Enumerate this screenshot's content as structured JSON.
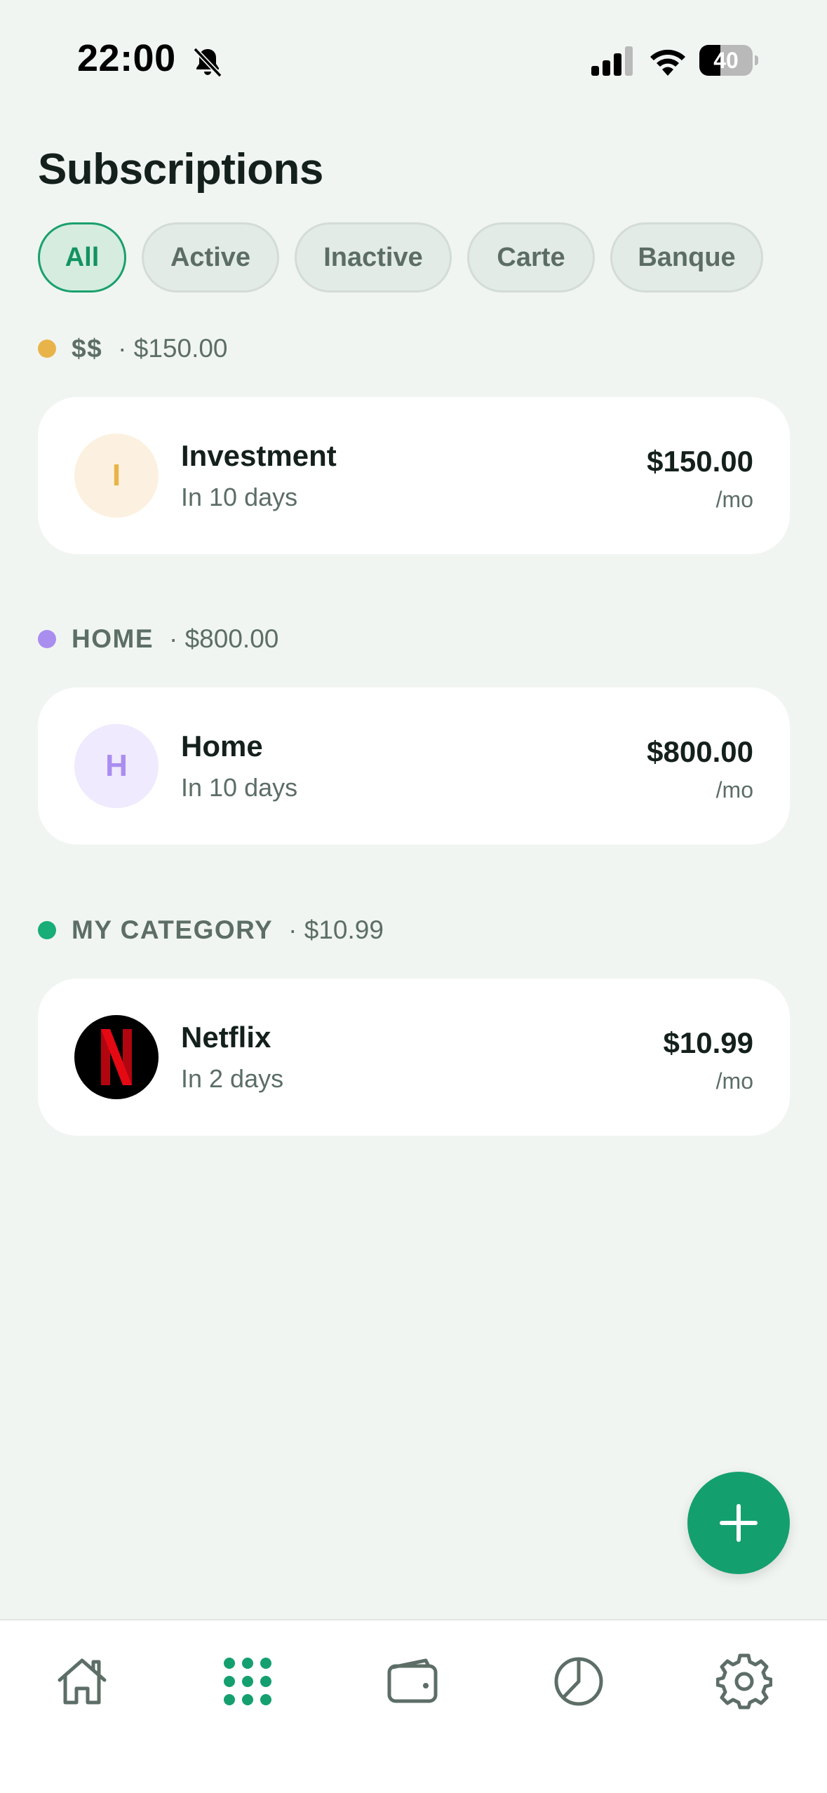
{
  "status_bar": {
    "time": "22:00",
    "battery_level": "40",
    "battery_fraction": 0.4
  },
  "page": {
    "title": "Subscriptions"
  },
  "filters": {
    "chips": [
      {
        "label": "All",
        "selected": true
      },
      {
        "label": "Active",
        "selected": false
      },
      {
        "label": "Inactive",
        "selected": false
      },
      {
        "label": "Carte",
        "selected": false
      },
      {
        "label": "Banque",
        "selected": false
      }
    ]
  },
  "sections": [
    {
      "name": "$$",
      "total": "· $150.00",
      "color": "#e8b44a",
      "items": [
        {
          "name": "Investment",
          "due": "In 10 days",
          "price": "$150.00",
          "period": "/mo",
          "initial": "I",
          "avatar_bg": "#fcf1e0",
          "avatar_fg": "#e8b44a"
        }
      ]
    },
    {
      "name": "HOME",
      "total": "· $800.00",
      "color": "#a98ef0",
      "items": [
        {
          "name": "Home",
          "due": "In 10 days",
          "price": "$800.00",
          "period": "/mo",
          "initial": "H",
          "avatar_bg": "#efeafd",
          "avatar_fg": "#a98ef0"
        }
      ]
    },
    {
      "name": "MY CATEGORY",
      "total": "· $10.99",
      "color": "#19ad78",
      "items": [
        {
          "name": "Netflix",
          "due": "In 2 days",
          "price": "$10.99",
          "period": "/mo",
          "icon": "netflix-logo"
        }
      ]
    }
  ],
  "tab_bar": {
    "tabs": [
      {
        "icon": "home-icon",
        "selected": false
      },
      {
        "icon": "grid-icon",
        "selected": true
      },
      {
        "icon": "wallet-icon",
        "selected": false
      },
      {
        "icon": "pie-chart-icon",
        "selected": false
      },
      {
        "icon": "gear-icon",
        "selected": false
      }
    ],
    "accent_color": "#14a06e",
    "inactive_color": "#5c6e66"
  },
  "fab": {
    "icon": "plus-icon"
  }
}
